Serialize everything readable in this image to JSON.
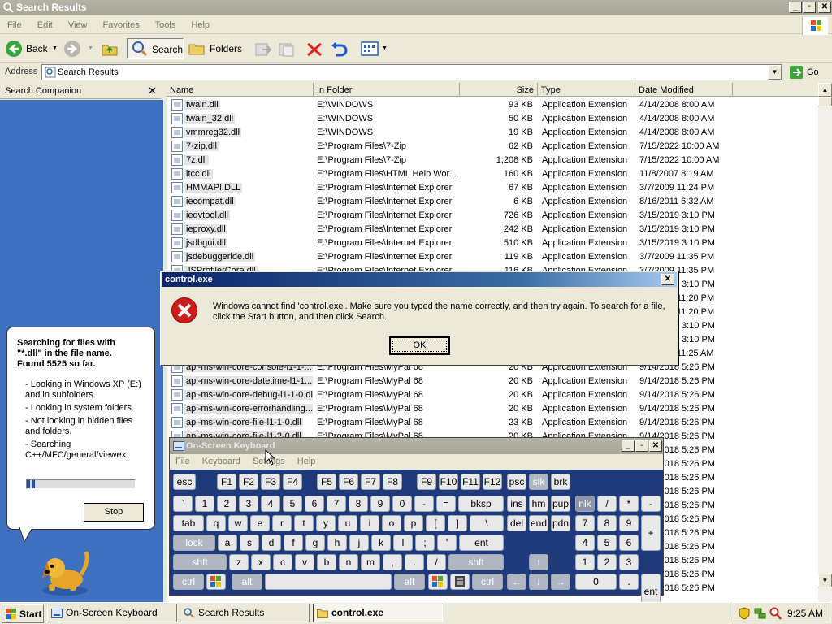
{
  "window": {
    "title": "Search Results"
  },
  "menu": [
    "File",
    "Edit",
    "View",
    "Favorites",
    "Tools",
    "Help"
  ],
  "toolbar": {
    "back": "Back",
    "search": "Search",
    "folders": "Folders"
  },
  "address": {
    "label": "Address",
    "value": "Search Results",
    "go": "Go"
  },
  "companion": {
    "title": "Search Companion",
    "heading": "Searching for files with \"*.dll\" in the file name. Found 5525 so far.",
    "notes": [
      "- Looking in Windows XP (E:) and in subfolders.",
      "- Looking in system folders.",
      "- Not looking in hidden files and folders.",
      "- Searching C++/MFC/general/viewex"
    ],
    "stop": "Stop",
    "progress": 0.1
  },
  "columns": [
    "Name",
    "In Folder",
    "Size",
    "Type",
    "Date Modified"
  ],
  "rows": [
    [
      "twain.dll",
      "E:\\WINDOWS",
      "93 KB",
      "Application Extension",
      "4/14/2008 8:00 AM"
    ],
    [
      "twain_32.dll",
      "E:\\WINDOWS",
      "50 KB",
      "Application Extension",
      "4/14/2008 8:00 AM"
    ],
    [
      "vmmreg32.dll",
      "E:\\WINDOWS",
      "19 KB",
      "Application Extension",
      "4/14/2008 8:00 AM"
    ],
    [
      "7-zip.dll",
      "E:\\Program Files\\7-Zip",
      "62 KB",
      "Application Extension",
      "7/15/2022 10:00 AM"
    ],
    [
      "7z.dll",
      "E:\\Program Files\\7-Zip",
      "1,208 KB",
      "Application Extension",
      "7/15/2022 10:00 AM"
    ],
    [
      "itcc.dll",
      "E:\\Program Files\\HTML Help Wor...",
      "160 KB",
      "Application Extension",
      "11/8/2007 8:19 AM"
    ],
    [
      "HMMAPI.DLL",
      "E:\\Program Files\\Internet Explorer",
      "67 KB",
      "Application Extension",
      "3/7/2009 11:24 PM"
    ],
    [
      "iecompat.dll",
      "E:\\Program Files\\Internet Explorer",
      "6 KB",
      "Application Extension",
      "8/16/2011 6:32 AM"
    ],
    [
      "iedvtool.dll",
      "E:\\Program Files\\Internet Explorer",
      "726 KB",
      "Application Extension",
      "3/15/2019 3:10 PM"
    ],
    [
      "ieproxy.dll",
      "E:\\Program Files\\Internet Explorer",
      "242 KB",
      "Application Extension",
      "3/15/2019 3:10 PM"
    ],
    [
      "jsdbgui.dll",
      "E:\\Program Files\\Internet Explorer",
      "510 KB",
      "Application Extension",
      "3/15/2019 3:10 PM"
    ],
    [
      "jsdebuggeride.dll",
      "E:\\Program Files\\Internet Explorer",
      "119 KB",
      "Application Extension",
      "3/7/2009 11:35 PM"
    ],
    [
      "JSProfilerCore.dll",
      "E:\\Program Files\\Internet Explorer",
      "116 KB",
      "Application Extension",
      "3/7/2009 11:35 PM"
    ],
    [
      "",
      "",
      "",
      "",
      "3/15/2019 3:10 PM"
    ],
    [
      "",
      "",
      "",
      "",
      "3/7/2009 11:20 PM"
    ],
    [
      "",
      "",
      "",
      "",
      "3/7/2009 11:20 PM"
    ],
    [
      "",
      "",
      "",
      "",
      "3/15/2019 3:10 PM"
    ],
    [
      "",
      "",
      "",
      "",
      "3/15/2019 3:10 PM"
    ],
    [
      "",
      "",
      "",
      "",
      "3/7/2009 11:25 AM"
    ],
    [
      "api-ms-win-core-console-l1-1-...",
      "E:\\Program Files\\MyPal 68",
      "20 KB",
      "Application Extension",
      "9/14/2018 5:26 PM"
    ],
    [
      "api-ms-win-core-datetime-l1-1...",
      "E:\\Program Files\\MyPal 68",
      "20 KB",
      "Application Extension",
      "9/14/2018 5:26 PM"
    ],
    [
      "api-ms-win-core-debug-l1-1-0.dll",
      "E:\\Program Files\\MyPal 68",
      "20 KB",
      "Application Extension",
      "9/14/2018 5:26 PM"
    ],
    [
      "api-ms-win-core-errorhandling...",
      "E:\\Program Files\\MyPal 68",
      "20 KB",
      "Application Extension",
      "9/14/2018 5:26 PM"
    ],
    [
      "api-ms-win-core-file-l1-1-0.dll",
      "E:\\Program Files\\MyPal 68",
      "23 KB",
      "Application Extension",
      "9/14/2018 5:26 PM"
    ],
    [
      "api-ms-win-core-file-l1-2-0.dll",
      "E:\\Program Files\\MyPal 68",
      "20 KB",
      "Application Extension",
      "9/14/2018 5:26 PM"
    ],
    [
      "",
      "",
      "",
      "",
      "9/14/2018 5:26 PM"
    ],
    [
      "",
      "",
      "",
      "",
      "9/14/2018 5:26 PM"
    ],
    [
      "",
      "",
      "",
      "",
      "9/14/2018 5:26 PM"
    ],
    [
      "",
      "",
      "",
      "",
      "9/14/2018 5:26 PM"
    ],
    [
      "",
      "",
      "",
      "",
      "9/14/2018 5:26 PM"
    ],
    [
      "",
      "",
      "",
      "",
      "9/14/2018 5:26 PM"
    ],
    [
      "",
      "",
      "",
      "",
      "9/14/2018 5:26 PM"
    ],
    [
      "",
      "",
      "",
      "",
      "9/14/2018 5:26 PM"
    ],
    [
      "",
      "",
      "",
      "",
      "9/14/2018 5:26 PM"
    ],
    [
      "",
      "",
      "",
      "",
      "9/14/2018 5:26 PM"
    ],
    [
      "",
      "",
      "",
      "",
      "9/14/2018 5:26 PM"
    ]
  ],
  "dialog": {
    "title": "control.exe",
    "message": "Windows cannot find 'control.exe'. Make sure you typed the name correctly, and then try again. To search for a file, click the Start button, and then click Search.",
    "ok": "OK"
  },
  "osk": {
    "title": "On-Screen Keyboard",
    "menu": [
      "File",
      "Keyboard",
      "Settings",
      "Help"
    ],
    "rows": [
      [
        "esc",
        "F1",
        "F2",
        "F3",
        "F4",
        "F5",
        "F6",
        "F7",
        "F8",
        "F9",
        "F10",
        "F11",
        "F12",
        "psc",
        "slk",
        "brk"
      ],
      [
        "`",
        "1",
        "2",
        "3",
        "4",
        "5",
        "6",
        "7",
        "8",
        "9",
        "0",
        "-",
        "=",
        "bksp",
        "ins",
        "hm",
        "pup",
        "nlk",
        "/",
        "*",
        "-"
      ],
      [
        "tab",
        "q",
        "w",
        "e",
        "r",
        "t",
        "y",
        "u",
        "i",
        "o",
        "p",
        "[",
        "]",
        "\\",
        "del",
        "end",
        "pdn",
        "7",
        "8",
        "9",
        "+"
      ],
      [
        "lock",
        "a",
        "s",
        "d",
        "f",
        "g",
        "h",
        "j",
        "k",
        "l",
        ";",
        "'",
        "ent",
        "4",
        "5",
        "6"
      ],
      [
        "shft",
        "z",
        "x",
        "c",
        "v",
        "b",
        "n",
        "m",
        ",",
        ".",
        "/",
        "shft",
        "↑",
        "1",
        "2",
        "3"
      ],
      [
        "ctrl",
        "alt",
        "alt",
        "ctrl",
        "←",
        "↓",
        "→",
        "0",
        ".",
        "ent"
      ]
    ]
  },
  "taskbar": {
    "start": "Start",
    "tasks": [
      "On-Screen Keyboard",
      "Search Results",
      "control.exe"
    ],
    "clock": "9:25 AM"
  },
  "colors": {
    "companion_bg": "#3f6fbf",
    "error_red": "#d11a1a",
    "osk_bg": "#1e3a7a"
  }
}
